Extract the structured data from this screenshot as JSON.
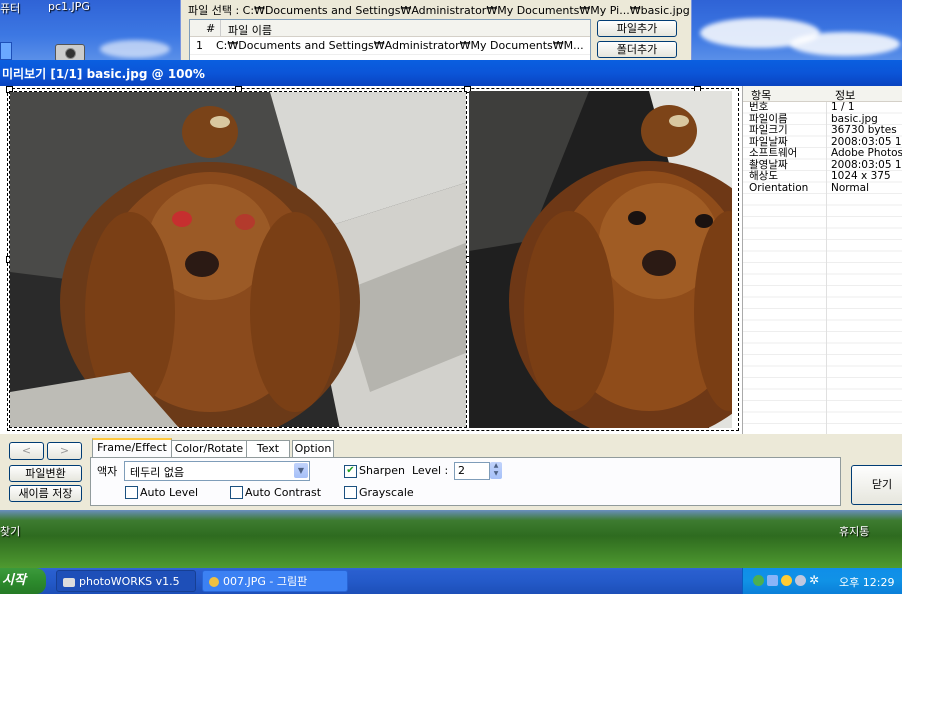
{
  "desktop": {
    "icon_labels": [
      "퓨터",
      "pc1.JPG"
    ],
    "bottom_left_label": "찾기",
    "recycle_bin_label": "휴지통"
  },
  "background_window": {
    "file_select_label": "파일 선택 : C:₩Documents and Settings₩Administrator₩My Documents₩My Pi...₩basic.jpg",
    "list_headers": [
      "#",
      "파일 이름"
    ],
    "list_rows": [
      {
        "num": "1",
        "path": "C:₩Documents and Settings₩Administrator₩My Documents₩M..."
      }
    ],
    "add_file_button": "파일추가",
    "add_folder_button": "폴더추가"
  },
  "preview_window": {
    "title": "미리보기 [1/1] basic.jpg @ 100%",
    "info_headers": [
      "항목",
      "정보"
    ],
    "info_rows": [
      {
        "key": "번호",
        "value": "1 / 1"
      },
      {
        "key": "파일이름",
        "value": "basic.jpg"
      },
      {
        "key": "파일크기",
        "value": "36730 bytes"
      },
      {
        "key": "파일날짜",
        "value": "2008:03:05 11:"
      },
      {
        "key": "소프트웨어",
        "value": "Adobe Photos"
      },
      {
        "key": "촬영날짜",
        "value": "2008:03:05 11:"
      },
      {
        "key": "해상도",
        "value": "1024 x 375"
      },
      {
        "key": "Orientation",
        "value": "Normal"
      }
    ],
    "nav_prev": "<",
    "nav_next": ">",
    "convert_button": "파일변환",
    "save_as_button": "새이름 저장",
    "close_button": "닫기",
    "tabs": [
      "Frame/Effect",
      "Color/Rotate",
      "Text",
      "Option"
    ],
    "active_tab": "Frame/Effect",
    "frame_label": "액자",
    "frame_value": "테두리 없음",
    "auto_level_label": "Auto Level",
    "auto_level_checked": false,
    "auto_contrast_label": "Auto Contrast",
    "auto_contrast_checked": false,
    "sharpen_label": "Sharpen",
    "sharpen_checked": true,
    "level_label": "Level :",
    "level_value": "2",
    "grayscale_label": "Grayscale",
    "grayscale_checked": false
  },
  "taskbar": {
    "start_label": "시작",
    "tasks": [
      {
        "label": "photoWORKS v1.5",
        "icon": "camera-icon"
      },
      {
        "label": "007.JPG - 그림판",
        "icon": "paint-icon"
      }
    ],
    "clock": "오후 12:29"
  }
}
